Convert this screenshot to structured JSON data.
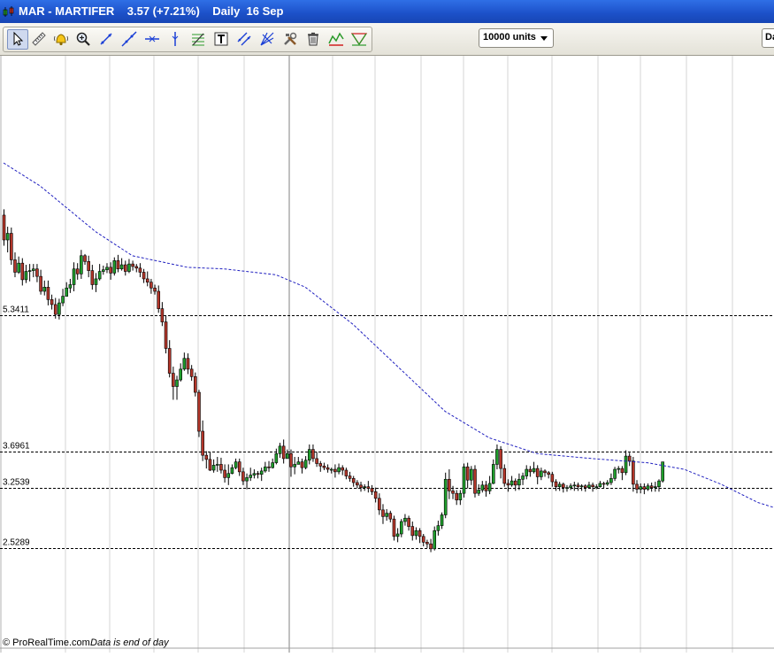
{
  "window": {
    "title": "MAR - MARTIFER    3.57 (+7.21%)    Daily  16 Sep"
  },
  "toolbar": {
    "tools": [
      {
        "name": "pointer-icon"
      },
      {
        "name": "ruler-icon"
      },
      {
        "name": "alarm-bell-icon"
      },
      {
        "name": "zoom-icon"
      },
      {
        "name": "segment-icon"
      },
      {
        "name": "trendline-icon"
      },
      {
        "name": "horizontal-line-icon"
      },
      {
        "name": "vertical-line-icon"
      },
      {
        "name": "fibonacci-icon"
      },
      {
        "name": "text-icon"
      },
      {
        "name": "parallel-lines-icon"
      },
      {
        "name": "fan-icon"
      },
      {
        "name": "tools-icon"
      },
      {
        "name": "trash-icon"
      },
      {
        "name": "pattern-icon"
      },
      {
        "name": "channel-icon"
      }
    ],
    "units_label": "10000 units",
    "period_label": "Da"
  },
  "chart_data": {
    "type": "candlestick",
    "title": "MAR - MARTIFER",
    "last": 3.57,
    "change": "+7.21%",
    "period": "Daily",
    "date": "16 Sep",
    "ylim": [
      2.0,
      7.5
    ],
    "grid": true,
    "horizontal_levels": [
      {
        "label": "5.3411",
        "value": 5.3411
      },
      {
        "label": "3.6961",
        "value": 3.6961
      },
      {
        "label": "3.2539",
        "value": 3.2539
      },
      {
        "label": "2.5289",
        "value": 2.5289
      }
    ],
    "moving_average": [
      [
        0,
        7.18
      ],
      [
        10,
        6.9
      ],
      [
        25,
        6.35
      ],
      [
        35,
        6.06
      ],
      [
        50,
        5.92
      ],
      [
        60,
        5.9
      ],
      [
        74,
        5.83
      ],
      [
        82,
        5.68
      ],
      [
        95,
        5.23
      ],
      [
        110,
        4.6
      ],
      [
        120,
        4.18
      ],
      [
        132,
        3.86
      ],
      [
        145,
        3.67
      ],
      [
        160,
        3.61
      ],
      [
        175,
        3.56
      ],
      [
        185,
        3.48
      ],
      [
        195,
        3.3
      ],
      [
        205,
        3.08
      ],
      [
        215,
        2.94
      ],
      [
        224,
        2.94
      ],
      [
        235,
        3.03
      ],
      [
        250,
        3.18
      ],
      [
        265,
        3.3
      ],
      [
        280,
        3.38
      ],
      [
        300,
        3.34
      ],
      [
        320,
        3.3
      ],
      [
        340,
        3.3
      ],
      [
        352,
        3.28
      ]
    ],
    "candles": [
      [
        6.55,
        6.25,
        6.62,
        6.18
      ],
      [
        6.25,
        6.33,
        6.41,
        6.1
      ],
      [
        6.33,
        6.01,
        6.4,
        5.95
      ],
      [
        6.01,
        5.86,
        6.1,
        5.8
      ],
      [
        5.86,
        5.97,
        6.05,
        5.84
      ],
      [
        5.97,
        5.77,
        6.03,
        5.7
      ],
      [
        5.77,
        5.87,
        5.95,
        5.73
      ],
      [
        5.87,
        5.88,
        5.96,
        5.75
      ],
      [
        5.88,
        5.9,
        5.96,
        5.8
      ],
      [
        5.9,
        5.81,
        5.96,
        5.74
      ],
      [
        5.81,
        5.63,
        5.89,
        5.59
      ],
      [
        5.63,
        5.68,
        5.76,
        5.58
      ],
      [
        5.68,
        5.53,
        5.76,
        5.46
      ],
      [
        5.53,
        5.47,
        5.59,
        5.41
      ],
      [
        5.47,
        5.35,
        5.55,
        5.3
      ],
      [
        5.35,
        5.49,
        5.54,
        5.29
      ],
      [
        5.49,
        5.57,
        5.66,
        5.45
      ],
      [
        5.57,
        5.67,
        5.74,
        5.57
      ],
      [
        5.67,
        5.71,
        5.78,
        5.61
      ],
      [
        5.71,
        5.9,
        5.98,
        5.63
      ],
      [
        5.9,
        5.84,
        5.97,
        5.77
      ],
      [
        5.84,
        6.06,
        6.13,
        5.78
      ],
      [
        6.06,
        5.99,
        6.08,
        5.95
      ],
      [
        5.99,
        5.88,
        6.06,
        5.8
      ],
      [
        5.88,
        5.71,
        5.95,
        5.65
      ],
      [
        5.71,
        5.78,
        5.85,
        5.62
      ],
      [
        5.78,
        5.87,
        5.96,
        5.76
      ],
      [
        5.87,
        5.89,
        5.94,
        5.83
      ],
      [
        5.89,
        5.92,
        5.97,
        5.85
      ],
      [
        5.92,
        5.85,
        5.98,
        5.77
      ],
      [
        5.85,
        6.0,
        6.04,
        5.82
      ],
      [
        6.0,
        5.9,
        6.07,
        5.86
      ],
      [
        5.9,
        5.95,
        6.03,
        5.88
      ],
      [
        5.95,
        5.87,
        6.0,
        5.82
      ],
      [
        5.87,
        5.96,
        6.02,
        5.85
      ],
      [
        5.96,
        5.93,
        6.0,
        5.88
      ],
      [
        5.93,
        5.91,
        5.96,
        5.86
      ],
      [
        5.91,
        5.86,
        5.97,
        5.8
      ],
      [
        5.86,
        5.78,
        5.9,
        5.73
      ],
      [
        5.78,
        5.74,
        5.87,
        5.69
      ],
      [
        5.74,
        5.67,
        5.78,
        5.6
      ],
      [
        5.67,
        5.63,
        5.71,
        5.59
      ],
      [
        5.63,
        5.42,
        5.7,
        5.37
      ],
      [
        5.42,
        5.26,
        5.5,
        5.21
      ],
      [
        5.26,
        4.94,
        5.33,
        4.88
      ],
      [
        4.94,
        4.64,
        5.04,
        4.59
      ],
      [
        4.64,
        4.48,
        4.72,
        4.32
      ],
      [
        4.48,
        4.56,
        4.61,
        4.32
      ],
      [
        4.56,
        4.69,
        4.76,
        4.54
      ],
      [
        4.69,
        4.82,
        4.89,
        4.67
      ],
      [
        4.82,
        4.69,
        4.88,
        4.63
      ],
      [
        4.69,
        4.6,
        4.74,
        4.55
      ],
      [
        4.6,
        4.41,
        4.65,
        4.36
      ],
      [
        4.41,
        3.94,
        4.44,
        3.87
      ],
      [
        3.94,
        3.65,
        4.07,
        3.58
      ],
      [
        3.65,
        3.6,
        3.7,
        3.49
      ],
      [
        3.6,
        3.47,
        3.69,
        3.46
      ],
      [
        3.47,
        3.53,
        3.6,
        3.44
      ],
      [
        3.53,
        3.54,
        3.63,
        3.45
      ],
      [
        3.54,
        3.47,
        3.62,
        3.43
      ],
      [
        3.47,
        3.38,
        3.54,
        3.32
      ],
      [
        3.38,
        3.43,
        3.54,
        3.29
      ],
      [
        3.43,
        3.5,
        3.54,
        3.42
      ],
      [
        3.5,
        3.57,
        3.61,
        3.48
      ],
      [
        3.57,
        3.45,
        3.61,
        3.4
      ],
      [
        3.45,
        3.34,
        3.5,
        3.29
      ],
      [
        3.34,
        3.38,
        3.43,
        3.24
      ],
      [
        3.38,
        3.41,
        3.5,
        3.34
      ],
      [
        3.41,
        3.43,
        3.48,
        3.37
      ],
      [
        3.43,
        3.42,
        3.46,
        3.37
      ],
      [
        3.42,
        3.46,
        3.5,
        3.34
      ],
      [
        3.46,
        3.51,
        3.57,
        3.44
      ],
      [
        3.51,
        3.5,
        3.58,
        3.45
      ],
      [
        3.5,
        3.56,
        3.61,
        3.49
      ],
      [
        3.56,
        3.67,
        3.73,
        3.54
      ],
      [
        3.67,
        3.76,
        3.8,
        3.62
      ],
      [
        3.76,
        3.61,
        3.84,
        3.55
      ],
      [
        3.61,
        3.67,
        3.72,
        3.61
      ],
      [
        3.67,
        3.51,
        3.72,
        3.39
      ],
      [
        3.51,
        3.54,
        3.63,
        3.42
      ],
      [
        3.54,
        3.57,
        3.63,
        3.54
      ],
      [
        3.57,
        3.5,
        3.61,
        3.43
      ],
      [
        3.5,
        3.59,
        3.64,
        3.48
      ],
      [
        3.59,
        3.72,
        3.78,
        3.54
      ],
      [
        3.72,
        3.61,
        3.78,
        3.57
      ],
      [
        3.61,
        3.55,
        3.69,
        3.51
      ],
      [
        3.55,
        3.52,
        3.58,
        3.45
      ],
      [
        3.52,
        3.5,
        3.56,
        3.47
      ],
      [
        3.5,
        3.48,
        3.54,
        3.44
      ],
      [
        3.48,
        3.48,
        3.5,
        3.43
      ],
      [
        3.48,
        3.45,
        3.54,
        3.38
      ],
      [
        3.45,
        3.5,
        3.55,
        3.42
      ],
      [
        3.5,
        3.47,
        3.53,
        3.41
      ],
      [
        3.47,
        3.4,
        3.5,
        3.36
      ],
      [
        3.4,
        3.37,
        3.45,
        3.33
      ],
      [
        3.37,
        3.32,
        3.4,
        3.27
      ],
      [
        3.32,
        3.29,
        3.35,
        3.25
      ],
      [
        3.29,
        3.26,
        3.33,
        3.21
      ],
      [
        3.26,
        3.27,
        3.3,
        3.22
      ],
      [
        3.27,
        3.25,
        3.34,
        3.2
      ],
      [
        3.25,
        3.21,
        3.29,
        3.17
      ],
      [
        3.21,
        3.13,
        3.26,
        3.08
      ],
      [
        3.13,
        2.99,
        3.19,
        2.93
      ],
      [
        2.99,
        2.91,
        3.06,
        2.82
      ],
      [
        2.91,
        2.95,
        3.0,
        2.86
      ],
      [
        2.95,
        2.88,
        2.98,
        2.84
      ],
      [
        2.88,
        2.67,
        2.92,
        2.62
      ],
      [
        2.67,
        2.7,
        2.77,
        2.6
      ],
      [
        2.7,
        2.85,
        2.88,
        2.66
      ],
      [
        2.85,
        2.89,
        2.94,
        2.8
      ],
      [
        2.89,
        2.79,
        2.92,
        2.74
      ],
      [
        2.79,
        2.68,
        2.85,
        2.62
      ],
      [
        2.68,
        2.74,
        2.78,
        2.63
      ],
      [
        2.74,
        2.67,
        2.77,
        2.59
      ],
      [
        2.67,
        2.6,
        2.7,
        2.55
      ],
      [
        2.6,
        2.58,
        2.63,
        2.53
      ],
      [
        2.58,
        2.52,
        2.64,
        2.48
      ],
      [
        2.52,
        2.74,
        2.79,
        2.5
      ],
      [
        2.74,
        2.8,
        2.86,
        2.68
      ],
      [
        2.8,
        2.93,
        2.96,
        2.76
      ],
      [
        2.93,
        3.36,
        3.44,
        2.89
      ],
      [
        3.36,
        3.22,
        3.48,
        3.12
      ],
      [
        3.22,
        3.19,
        3.28,
        3.12
      ],
      [
        3.19,
        3.11,
        3.23,
        3.05
      ],
      [
        3.11,
        3.19,
        3.23,
        3.05
      ],
      [
        3.19,
        3.51,
        3.55,
        3.14
      ],
      [
        3.51,
        3.35,
        3.56,
        3.25
      ],
      [
        3.35,
        3.48,
        3.52,
        3.29
      ],
      [
        3.48,
        3.19,
        3.53,
        3.14
      ],
      [
        3.19,
        3.23,
        3.3,
        3.16
      ],
      [
        3.23,
        3.29,
        3.34,
        3.2
      ],
      [
        3.29,
        3.22,
        3.34,
        3.15
      ],
      [
        3.22,
        3.31,
        3.4,
        3.18
      ],
      [
        3.31,
        3.54,
        3.6,
        3.3
      ],
      [
        3.54,
        3.72,
        3.78,
        3.48
      ],
      [
        3.72,
        3.49,
        3.76,
        3.37
      ],
      [
        3.49,
        3.31,
        3.54,
        3.27
      ],
      [
        3.31,
        3.29,
        3.36,
        3.21
      ],
      [
        3.29,
        3.34,
        3.4,
        3.27
      ],
      [
        3.34,
        3.29,
        3.37,
        3.22
      ],
      [
        3.29,
        3.36,
        3.43,
        3.23
      ],
      [
        3.36,
        3.4,
        3.44,
        3.29
      ],
      [
        3.4,
        3.48,
        3.53,
        3.36
      ],
      [
        3.48,
        3.45,
        3.52,
        3.39
      ],
      [
        3.45,
        3.49,
        3.57,
        3.43
      ],
      [
        3.49,
        3.39,
        3.53,
        3.3
      ],
      [
        3.39,
        3.46,
        3.5,
        3.35
      ],
      [
        3.46,
        3.44,
        3.48,
        3.39
      ],
      [
        3.44,
        3.42,
        3.46,
        3.37
      ],
      [
        3.42,
        3.33,
        3.45,
        3.27
      ],
      [
        3.33,
        3.27,
        3.36,
        3.22
      ],
      [
        3.27,
        3.3,
        3.33,
        3.22
      ],
      [
        3.3,
        3.26,
        3.32,
        3.2
      ],
      [
        3.26,
        3.26,
        3.29,
        3.21
      ],
      [
        3.26,
        3.28,
        3.31,
        3.23
      ],
      [
        3.28,
        3.29,
        3.33,
        3.22
      ],
      [
        3.29,
        3.27,
        3.32,
        3.22
      ],
      [
        3.27,
        3.28,
        3.3,
        3.22
      ],
      [
        3.28,
        3.26,
        3.3,
        3.21
      ],
      [
        3.26,
        3.29,
        3.33,
        3.25
      ],
      [
        3.29,
        3.27,
        3.32,
        3.21
      ],
      [
        3.27,
        3.27,
        3.3,
        3.24
      ],
      [
        3.27,
        3.31,
        3.34,
        3.26
      ],
      [
        3.31,
        3.3,
        3.33,
        3.25
      ],
      [
        3.3,
        3.32,
        3.35,
        3.28
      ],
      [
        3.32,
        3.37,
        3.43,
        3.29
      ],
      [
        3.37,
        3.48,
        3.51,
        3.34
      ],
      [
        3.48,
        3.49,
        3.52,
        3.43
      ],
      [
        3.49,
        3.44,
        3.52,
        3.35
      ],
      [
        3.44,
        3.64,
        3.71,
        3.41
      ],
      [
        3.64,
        3.58,
        3.68,
        3.52
      ],
      [
        3.58,
        3.3,
        3.63,
        3.21
      ],
      [
        3.3,
        3.24,
        3.35,
        3.19
      ],
      [
        3.24,
        3.27,
        3.31,
        3.19
      ],
      [
        3.27,
        3.24,
        3.31,
        3.18
      ],
      [
        3.24,
        3.28,
        3.31,
        3.22
      ],
      [
        3.28,
        3.26,
        3.32,
        3.21
      ],
      [
        3.26,
        3.27,
        3.33,
        3.21
      ],
      [
        3.27,
        3.34,
        3.36,
        3.21
      ],
      [
        3.34,
        3.57,
        3.57,
        3.32
      ]
    ]
  },
  "footer": {
    "copyright": "© ProRealTime.com",
    "note": "Data is end of day"
  }
}
